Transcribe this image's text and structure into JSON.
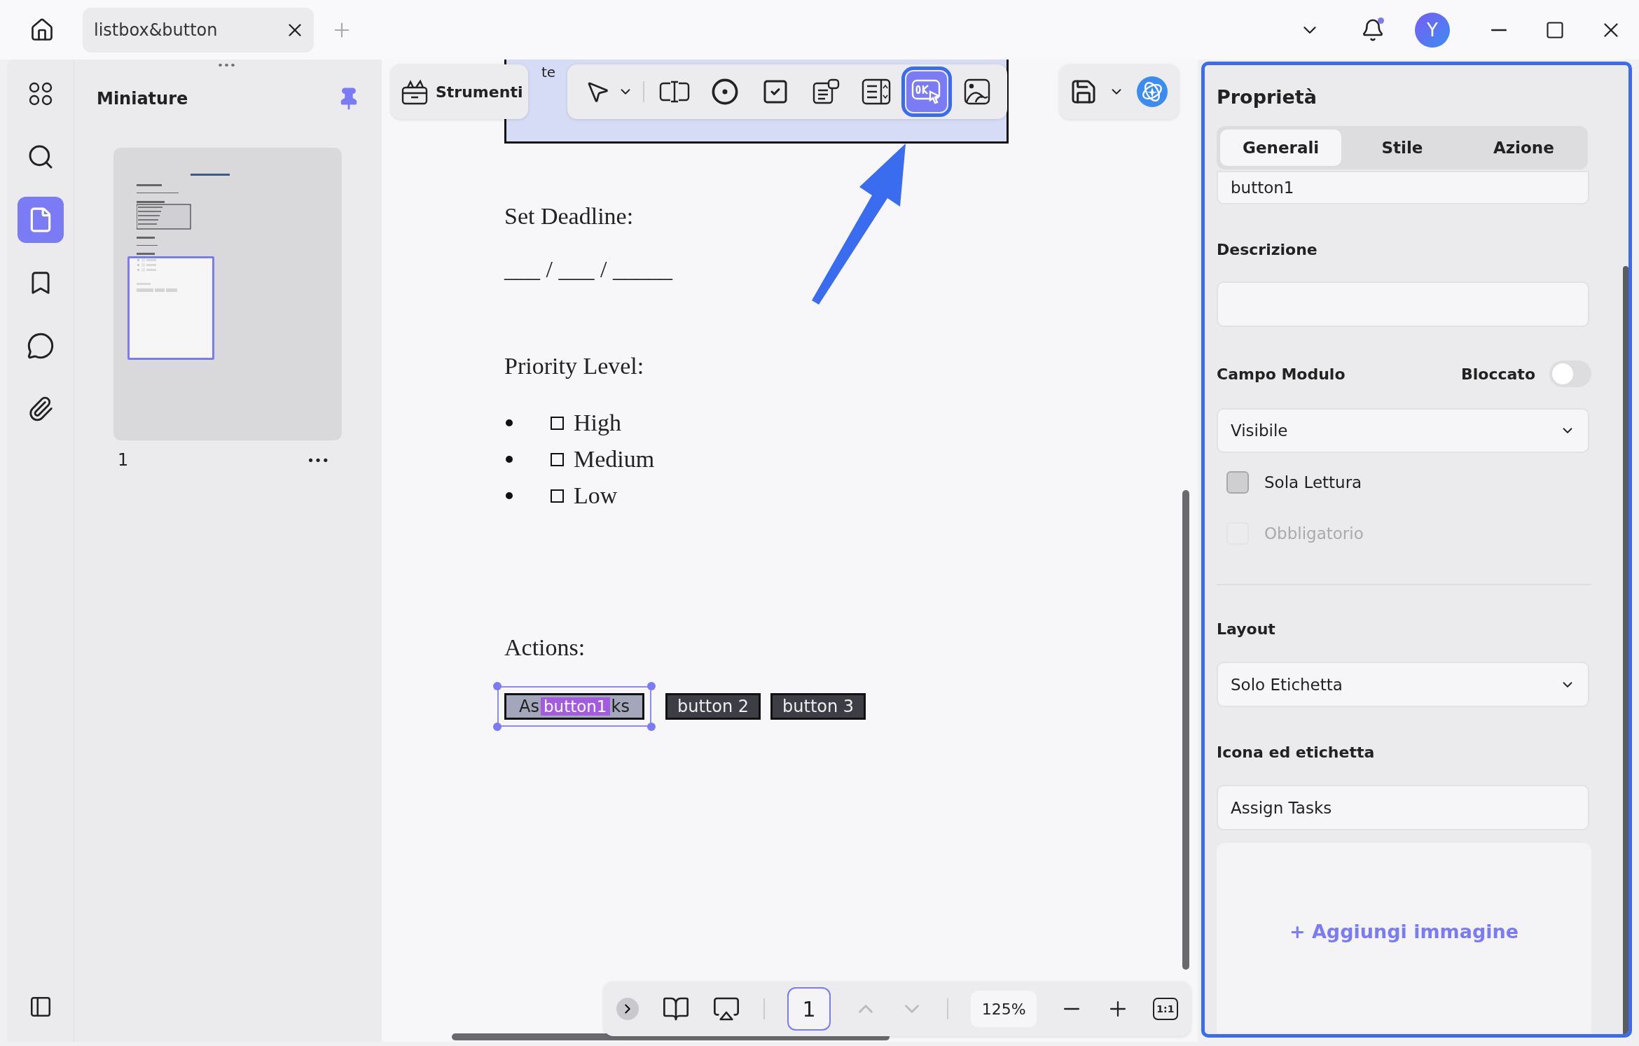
{
  "window": {
    "tab_title": "listbox&button",
    "avatar_letter": "Y",
    "notification": true
  },
  "sidebar": {
    "items": [
      {
        "kind": "thumbnails",
        "selected": false
      },
      {
        "kind": "search",
        "selected": false
      },
      {
        "kind": "pages",
        "selected": true
      },
      {
        "kind": "bookmarks",
        "selected": false
      },
      {
        "kind": "comments",
        "selected": false
      },
      {
        "kind": "attachments",
        "selected": false
      }
    ]
  },
  "thumbnails": {
    "title": "Miniature",
    "pinned": true,
    "page_label": "1",
    "more": "•••"
  },
  "toolbar": {
    "tools_label": "Strumenti",
    "tools": [
      {
        "kind": "select",
        "selected": false
      },
      {
        "kind": "text-field",
        "selected": false
      },
      {
        "kind": "radio",
        "selected": false
      },
      {
        "kind": "checkbox",
        "selected": false
      },
      {
        "kind": "combo",
        "selected": false
      },
      {
        "kind": "listbox",
        "selected": false
      },
      {
        "kind": "button",
        "selected": true
      },
      {
        "kind": "signature",
        "selected": false
      }
    ]
  },
  "document": {
    "listbox_text": "te",
    "deadline_label": "Set Deadline:",
    "date_blank": "___ / ___ / _____",
    "priority_label": "Priority Level:",
    "priority_options": [
      {
        "label": "High",
        "checked": false
      },
      {
        "label": "Medium",
        "checked": false
      },
      {
        "label": "Low",
        "checked": false
      }
    ],
    "actions_label": "Actions:",
    "form_buttons": [
      {
        "label": "button1",
        "value_start": "As",
        "value_end": "ks",
        "selected": true
      },
      {
        "label": "button 2",
        "selected": false
      },
      {
        "label": "button 3",
        "selected": false
      }
    ]
  },
  "bottom_bar": {
    "page": "1",
    "zoom": "125%",
    "fit_label": "1:1"
  },
  "properties": {
    "title": "Proprietà",
    "tabs": [
      {
        "label": "Generali",
        "selected": true
      },
      {
        "label": "Stile",
        "selected": false
      },
      {
        "label": "Azione",
        "selected": false
      }
    ],
    "name_value": "button1",
    "description_label": "Descrizione",
    "form_field_label": "Campo Modulo",
    "locked_label": "Bloccato",
    "locked": false,
    "visibility": "Visibile",
    "checkboxes": [
      {
        "label": "Sola Lettura",
        "checked": false,
        "disabled": false
      },
      {
        "label": "Obbligatorio",
        "checked": false,
        "disabled": true
      }
    ],
    "layout_label": "Layout",
    "layout_value": "Solo Etichetta",
    "icon_label_heading": "Icona ed etichetta",
    "label_value": "Assign Tasks",
    "add_image": "+ Aggiungi immagine"
  }
}
